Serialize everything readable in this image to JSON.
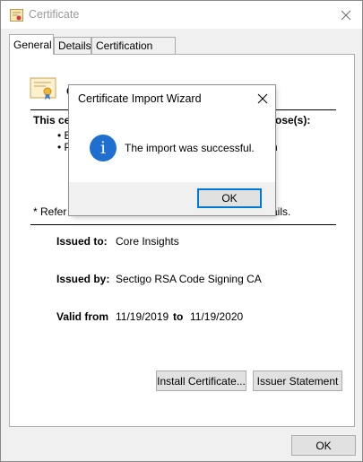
{
  "window": {
    "title": "Certificate",
    "icon": "certificate-icon",
    "close_icon": "close-icon"
  },
  "tabs": [
    {
      "label": "General",
      "active": true
    },
    {
      "label": "Details",
      "active": false
    },
    {
      "label": "Certification Path",
      "active": false
    }
  ],
  "general": {
    "heading_visible": "C",
    "purpose_visible": "This cer",
    "purpose_tail": "ose(s):",
    "bullets": [
      {
        "visible": "• Er"
      },
      {
        "visible": "• Pr",
        "tail": "n"
      }
    ],
    "refer_visible": "* Refer t",
    "refer_tail": "ails.",
    "fields": {
      "issued_to_label": "Issued to:",
      "issued_to_value": "Core Insights",
      "issued_by_label": "Issued by:",
      "issued_by_value": "Sectigo RSA Code Signing CA",
      "valid_from_label": "Valid from",
      "valid_from_value": "11/19/2019",
      "valid_to_label": "to",
      "valid_to_value": "11/19/2020"
    },
    "buttons": {
      "install": "Install Certificate...",
      "issuer": "Issuer Statement"
    }
  },
  "footer": {
    "ok": "OK"
  },
  "dialog": {
    "title": "Certificate Import Wizard",
    "message": "The import was successful.",
    "ok": "OK",
    "icon": "info-icon",
    "accent": "#0078d7"
  }
}
